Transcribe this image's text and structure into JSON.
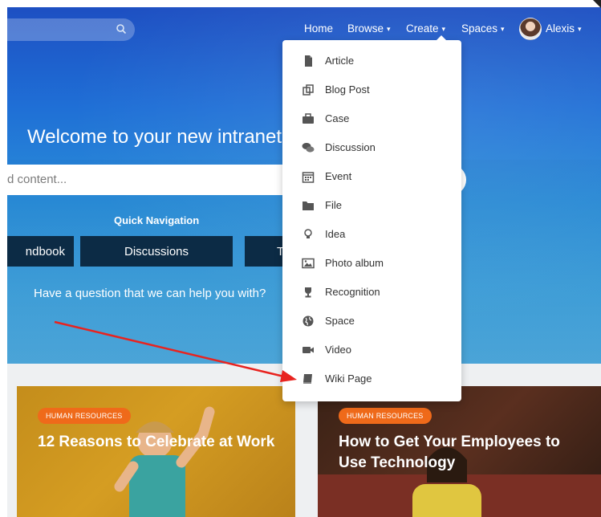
{
  "nav": {
    "home": "Home",
    "browse": "Browse",
    "create": "Create",
    "spaces": "Spaces",
    "user": "Alexis",
    "caret": "▾"
  },
  "hero": {
    "welcome": "Welcome to your new intranet",
    "search_placeholder": "d content...",
    "quick_nav_title": "Quick Navigation",
    "quick_nav_buttons": [
      "ndbook",
      "Discussions",
      "T"
    ],
    "question": "Have a question that we can help you with?"
  },
  "create_menu": {
    "items": [
      {
        "label": "Article",
        "icon": "document-icon"
      },
      {
        "label": "Blog Post",
        "icon": "blog-post-icon"
      },
      {
        "label": "Case",
        "icon": "briefcase-icon"
      },
      {
        "label": "Discussion",
        "icon": "chat-bubbles-icon"
      },
      {
        "label": "Event",
        "icon": "calendar-icon"
      },
      {
        "label": "File",
        "icon": "folder-icon"
      },
      {
        "label": "Idea",
        "icon": "lightbulb-icon"
      },
      {
        "label": "Photo album",
        "icon": "photo-icon"
      },
      {
        "label": "Recognition",
        "icon": "trophy-icon"
      },
      {
        "label": "Space",
        "icon": "globe-icon"
      },
      {
        "label": "Video",
        "icon": "video-camera-icon"
      },
      {
        "label": "Wiki Page",
        "icon": "book-icon"
      }
    ]
  },
  "cards": [
    {
      "badge": "HUMAN RESOURCES",
      "title": "12 Reasons to Celebrate at Work"
    },
    {
      "badge": "HUMAN RESOURCES",
      "title": "How to Get Your Employees to Use Technology"
    }
  ],
  "colors": {
    "hero_blue": "#1f6fd6",
    "badge_orange": "#ef6a1a",
    "quick_nav_button": "#0c2b45",
    "annotation_arrow": "#e8231f"
  }
}
